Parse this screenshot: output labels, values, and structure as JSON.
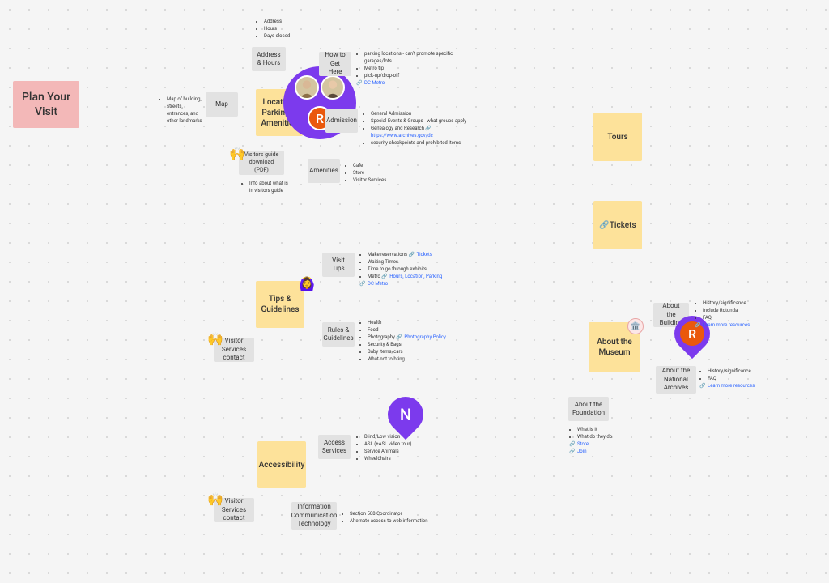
{
  "root": {
    "title": "Plan Your Visit"
  },
  "group1": {
    "label": "Location, Parking & Amenities",
    "map": "Map",
    "map_bullets": [
      "Map of building, streets, entrances, and other landmarks"
    ],
    "address": "Address & Hours",
    "address_bullets": [
      "Address",
      "Hours",
      "Days closed"
    ],
    "how": "How to Get Here",
    "how_bullets": [
      "parking locations - can't promote specific garages/lots",
      "Metro tip",
      "pick-up/drop-off"
    ],
    "how_link": "DC Metro",
    "admission": "Admission",
    "admission_bullets": [
      "General Admission",
      "Special Events & Groups - what groups apply",
      "Genealogy and Research",
      "security checkpoints and prohibited items"
    ],
    "admission_link": "https://www.archives.gov/dc",
    "amenities": "Amenities",
    "amenities_bullets": [
      "Cafe",
      "Store",
      "Visitor Services"
    ],
    "guide": "Visitors guide download (PDF)",
    "guide_bullets": [
      "Info about what is in visitors guide"
    ]
  },
  "tours": "Tours",
  "tickets": "Tickets",
  "tips": {
    "label": "Tips & Guidelines",
    "visit": "Visit Tips",
    "visit_bullets": [
      "Make reservations",
      "Waiting Times",
      "Time to go through exhibits",
      "Metro"
    ],
    "visit_link1": "Tickets",
    "visit_link2": "Hours, Location, Parking",
    "visit_link3": "DC Metro",
    "rules": "Rules & Guidelines",
    "rules_bullets": [
      "Health",
      "Food",
      "Photography",
      "Security & Bags",
      "Baby items/cars",
      "What not to bring"
    ],
    "rules_link": "Photography Policy",
    "contact": "Visitor Services contact"
  },
  "access": {
    "label": "Accessibility",
    "svc": "Access Services",
    "svc_bullets": [
      "Blind/Low vision",
      "ASL (+ASL video tour)",
      "Service Animals",
      "Wheelchairs"
    ],
    "ict": "Information Communication Technology",
    "ict_bullets": [
      "Section 508 Coordinator",
      "Alternate access to web information"
    ],
    "contact": "Visitor Services contact"
  },
  "about": {
    "label": "About the Museum",
    "bldg": "About the Building",
    "bldg_bullets": [
      "History/significance",
      "Include Rotunda",
      "FAQ"
    ],
    "bldg_link": "Learn more resources",
    "arch": "About the National Archives",
    "arch_bullets": [
      "History/significance",
      "FAQ"
    ],
    "arch_link": "Learn more resources",
    "fnd": "About the Foundation",
    "fnd_bullets": [
      "What is it",
      "What do they do"
    ],
    "fnd_link1": "Store",
    "fnd_link2": "Join"
  },
  "avatars": {
    "r": "R",
    "n": "N"
  }
}
